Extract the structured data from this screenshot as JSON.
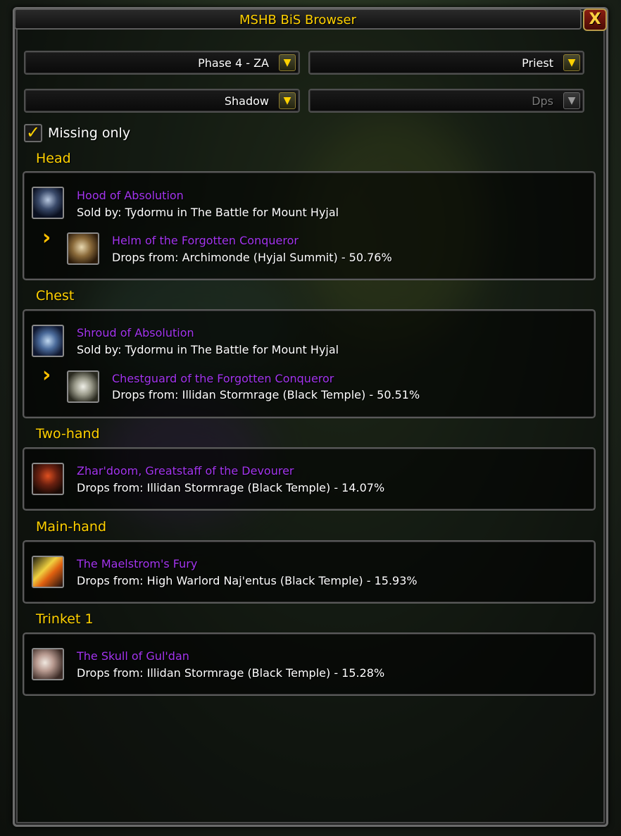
{
  "window": {
    "title": "MSHB BiS Browser",
    "close_glyph": "X"
  },
  "filters": {
    "phase": "Phase 4 - ZA",
    "class": "Priest",
    "spec": "Shadow",
    "role": "Dps"
  },
  "missing_only": {
    "label": "Missing only",
    "checked": true
  },
  "sections": [
    {
      "title": "Head",
      "item": {
        "name": "Hood of Absolution",
        "source": "Sold by: Tydormu in The Battle for Mount Hyjal",
        "icon": "hood-icon"
      },
      "token": {
        "name": "Helm of the Forgotten Conqueror",
        "source": "Drops from: Archimonde (Hyjal Summit)  - 50.76%",
        "icon": "helm-token-icon"
      }
    },
    {
      "title": "Chest",
      "item": {
        "name": "Shroud of Absolution",
        "source": "Sold by: Tydormu in The Battle for Mount Hyjal",
        "icon": "robe-icon"
      },
      "token": {
        "name": "Chestguard of the Forgotten Conqueror",
        "source": "Drops from: Illidan Stormrage (Black Temple)  - 50.51%",
        "icon": "chest-token-icon"
      }
    },
    {
      "title": "Two-hand",
      "item": {
        "name": "Zhar'doom, Greatstaff of the Devourer",
        "source": "Drops from: Illidan Stormrage (Black Temple)  - 14.07%",
        "icon": "staff-icon"
      }
    },
    {
      "title": "Main-hand",
      "item": {
        "name": "The Maelstrom's Fury",
        "source": "Drops from: High Warlord Naj'entus (Black Temple)  - 15.93%",
        "icon": "dagger-icon"
      }
    },
    {
      "title": "Trinket 1",
      "item": {
        "name": "The Skull of Gul'dan",
        "source": "Drops from: Illidan Stormrage (Black Temple)  - 15.28%",
        "icon": "skull-icon"
      }
    }
  ],
  "colors": {
    "epic": "#a335ee",
    "gold": "#ffd100",
    "text": "#ffffff"
  }
}
